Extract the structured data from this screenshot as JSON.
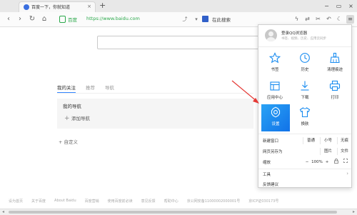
{
  "tab": {
    "title": "百度一下，你就知道",
    "close": "×",
    "new_tab": "+"
  },
  "window": {
    "minimize": "−",
    "maximize": "▭",
    "close": "×"
  },
  "toolbar": {
    "back": "‹",
    "forward": "›",
    "refresh": "↻",
    "reader": "⌂",
    "secure_label": "百度",
    "url": "https://www.baidu.com",
    "search_placeholder": "在此搜索",
    "icons": {
      "share": "⤴",
      "translate": "⇄",
      "cut": "✂",
      "undo": "↶",
      "night": "☾",
      "menu": "≡",
      "dropdown": "▾",
      "bolt": "ϟ"
    }
  },
  "page": {
    "tabs": [
      "我的关注",
      "推荐",
      "导航"
    ],
    "nav_title": "我的导航",
    "add_nav_plus": "+",
    "add_nav": "添加导航",
    "customize_plus": "+",
    "customize": "自定义",
    "footer": [
      "设为首页",
      "关于百度",
      "About Baidu",
      "百度营销",
      "使用百度前必读",
      "意见反馈",
      "帮助中心",
      "京公网安备11000002000001号",
      "京ICP证030173号"
    ]
  },
  "menu": {
    "login_title": "登录QQ浏览器",
    "login_sub": "书签、视频、历史、应用云同步",
    "grid": [
      {
        "label": "书签",
        "icon": "star-icon"
      },
      {
        "label": "历史",
        "icon": "clock-icon"
      },
      {
        "label": "清理痕迹",
        "icon": "broom-icon"
      },
      {
        "label": "应用中心",
        "icon": "puzzle-icon"
      },
      {
        "label": "下载",
        "icon": "download-icon"
      },
      {
        "label": "打印",
        "icon": "printer-icon"
      },
      {
        "label": "设置",
        "icon": "gear-icon"
      },
      {
        "label": "换肤",
        "icon": "shirt-icon"
      }
    ],
    "new_window": {
      "label": "新建窗口",
      "options": [
        "普通",
        "小号",
        "无痕"
      ]
    },
    "save_as": {
      "label": "网页另存为",
      "options": [
        "图片",
        "文件"
      ]
    },
    "zoom": {
      "label": "缩放",
      "minus": "−",
      "value": "100%",
      "plus": "+"
    },
    "tools": "工具",
    "feedback": "反馈建议",
    "chevron": "›"
  },
  "colors": {
    "accent": "#1a8cf0",
    "secure": "#2aa84a",
    "annotation": "#e53935"
  }
}
